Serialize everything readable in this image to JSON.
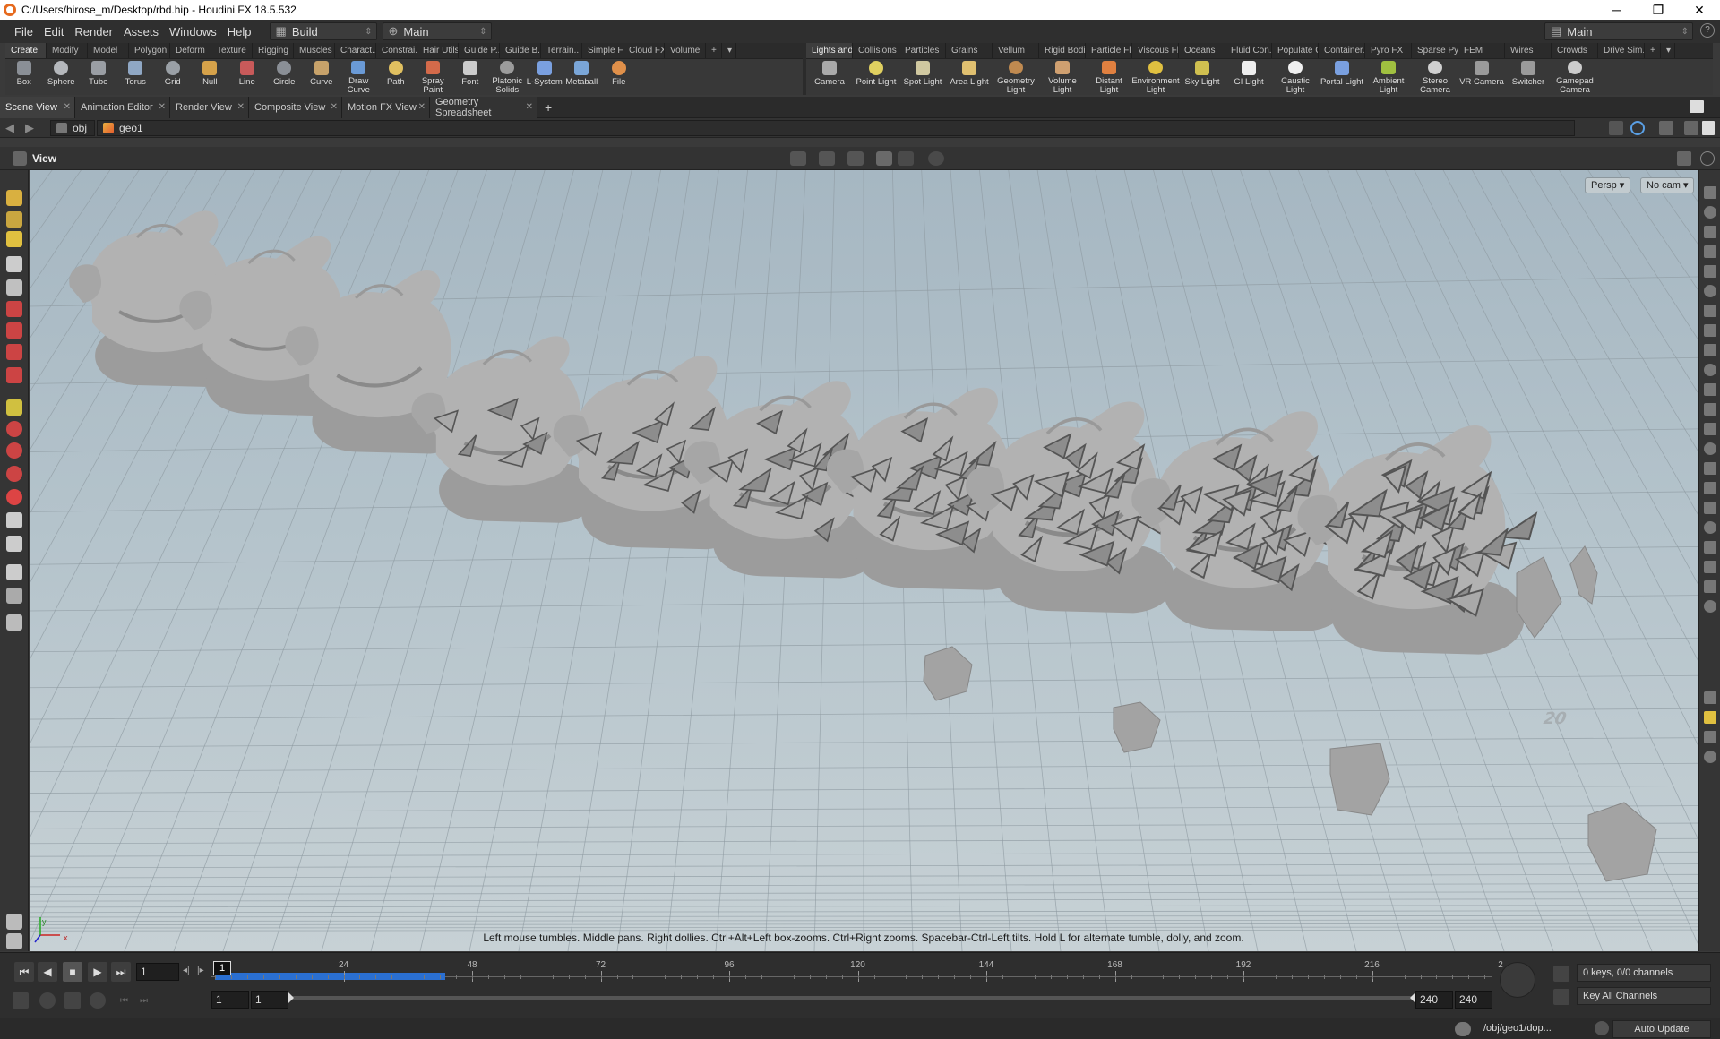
{
  "window": {
    "title": "C:/Users/hirose_m/Desktop/rbd.hip - Houdini FX 18.5.532",
    "min": "─",
    "max": "❐",
    "close": "✕"
  },
  "menu": [
    "File",
    "Edit",
    "Render",
    "Assets",
    "Windows",
    "Help"
  ],
  "desktop": {
    "build": "Build",
    "main": "Main",
    "right_main": "Main"
  },
  "shelf1": {
    "tabs": [
      "Create",
      "Modify",
      "Model",
      "Polygon",
      "Deform",
      "Texture",
      "Rigging",
      "Muscles",
      "Charact...",
      "Constrai...",
      "Hair Utils",
      "Guide P...",
      "Guide B...",
      "Terrain...",
      "Simple FX",
      "Cloud FX",
      "Volume"
    ],
    "tools": [
      "Box",
      "Sphere",
      "Tube",
      "Torus",
      "Grid",
      "Null",
      "Line",
      "Circle",
      "Curve",
      "Draw Curve",
      "Path",
      "Spray Paint",
      "Font",
      "Platonic Solids",
      "L-System",
      "Metaball",
      "File"
    ]
  },
  "shelf2": {
    "tabs": [
      "Lights and...",
      "Collisions",
      "Particles",
      "Grains",
      "Vellum",
      "Rigid Bodies",
      "Particle Fl...",
      "Viscous Fl...",
      "Oceans",
      "Fluid Con...",
      "Populate C...",
      "Container...",
      "Pyro FX",
      "Sparse Pyr...",
      "FEM",
      "Wires",
      "Crowds",
      "Drive Sim..."
    ],
    "tools": [
      "Camera",
      "Point Light",
      "Spot Light",
      "Area Light",
      "Geometry Light",
      "Volume Light",
      "Distant Light",
      "Environment Light",
      "Sky Light",
      "GI Light",
      "Caustic Light",
      "Portal Light",
      "Ambient Light",
      "Stereo Camera",
      "VR Camera",
      "Switcher",
      "Gamepad Camera"
    ]
  },
  "pane_tabs": [
    "Scene View",
    "Animation Editor",
    "Render View",
    "Composite View",
    "Motion FX View",
    "Geometry Spreadsheet"
  ],
  "path": {
    "root": "obj",
    "node": "geo1"
  },
  "viewer": {
    "title": "View",
    "persp": "Persp ▾",
    "cam": "No cam ▾",
    "grid_label": "20",
    "axis_y": "y",
    "axis_x": "x",
    "hint": "Left mouse tumbles. Middle pans. Right dollies. Ctrl+Alt+Left box-zooms. Ctrl+Right zooms. Spacebar-Ctrl-Left tilts. Hold L for alternate tumble, dolly, and zoom."
  },
  "timeline": {
    "current_frame": "1",
    "frame_marker": "1",
    "ticks": [
      "24",
      "48",
      "72",
      "96",
      "120",
      "144",
      "168",
      "192",
      "216",
      "2"
    ],
    "range_start": "1",
    "range_start2": "1",
    "range_end": "240",
    "range_end2": "240",
    "cached_fraction": 0.18,
    "keys": "0 keys, 0/0 channels",
    "key_all": "Key All Channels",
    "status_path": "/obj/geo1/dop...",
    "auto_update": "Auto Update"
  },
  "colors": {
    "accent": "#2a6fd1",
    "viewport_top": "#a6b7c2",
    "viewport_bottom": "#c7d1d5"
  }
}
